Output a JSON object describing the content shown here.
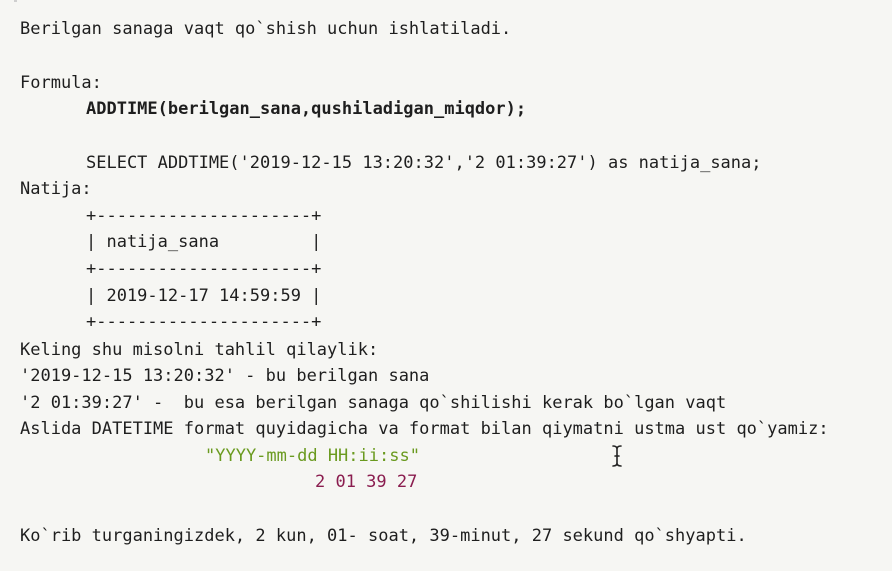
{
  "intro": "Berilgan sanaga vaqt qo`shish uchun ishlatiladi.",
  "formula_label": "Formula:",
  "formula": "ADDTIME(berilgan_sana,qushiladigan_miqdor);",
  "query": "SELECT ADDTIME('2019-12-15 13:20:32','2 01:39:27') as natija_sana;",
  "result_label": "Natija:",
  "table": {
    "border": "+---------------------+",
    "header": "| natija_sana         |",
    "row": "| 2019-12-17 14:59:59 |"
  },
  "analysis": {
    "heading": "Keling shu misolni tahlil qilaylik:",
    "line1": "'2019-12-15 13:20:32' - bu berilgan sana",
    "line2": "'2 01:39:27' -  bu esa berilgan sanaga qo`shilishi kerak bo`lgan vaqt",
    "line3": "Aslida DATETIME format quyidagicha va format bilan qiymatni ustma ust qo`yamiz:",
    "format": "\"YYYY-mm-dd HH:ii:ss\"",
    "value": "2 01 39 27"
  },
  "conclusion": "Ko`rib turganingizdek, 2 kun, 01- soat, 39-minut, 27 sekund qo`shyapti.",
  "colors": {
    "format_text": "#6a9a1f",
    "value_text": "#8a1d4f",
    "background": "#f6f6f3"
  },
  "icons": {
    "cursor": "text-cursor-icon"
  }
}
